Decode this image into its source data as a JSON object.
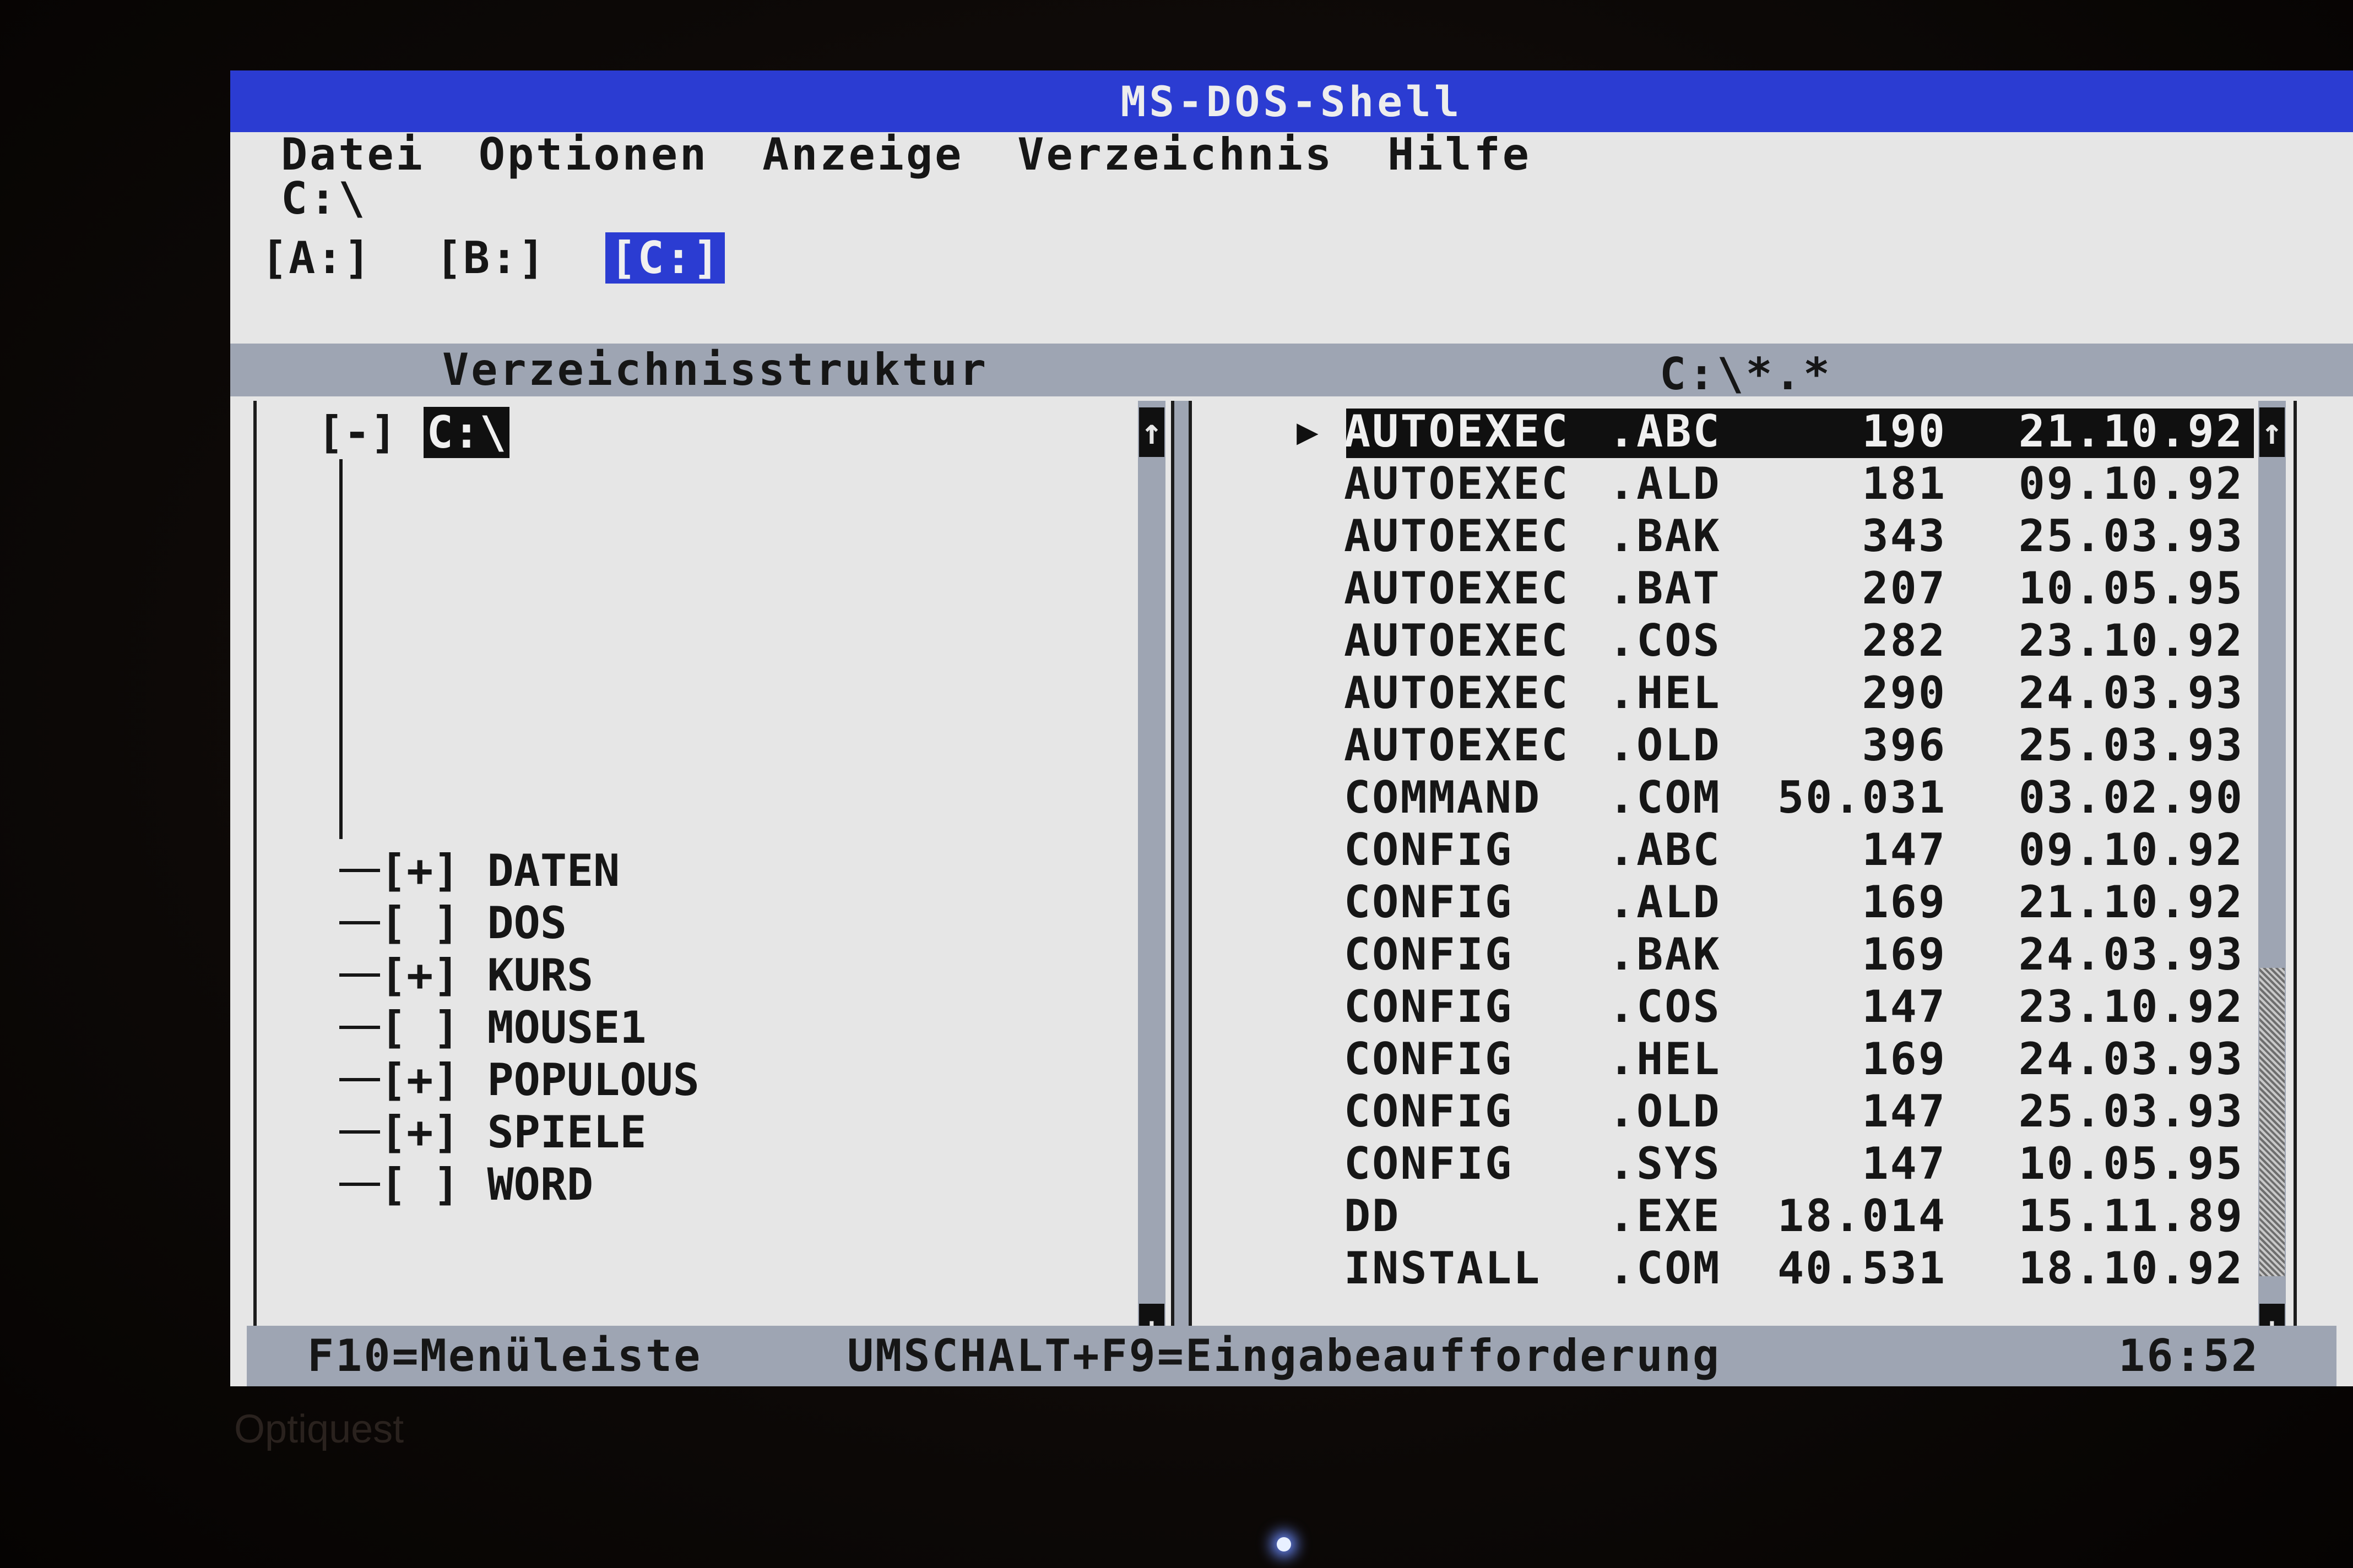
{
  "window": {
    "title": "MS-DOS-Shell"
  },
  "menu": [
    "Datei",
    "Optionen",
    "Anzeige",
    "Verzeichnis",
    "Hilfe"
  ],
  "current_path": "C:\\",
  "drives": [
    {
      "label": "[A:]",
      "active": false
    },
    {
      "label": "[B:]",
      "active": false
    },
    {
      "label": "[C:]",
      "active": true
    }
  ],
  "tree_panel": {
    "title": "Verzeichnisstruktur",
    "root": {
      "marker": "[-]",
      "name": "C:\\"
    },
    "nodes": [
      {
        "marker": "[+]",
        "name": "DATEN"
      },
      {
        "marker": "[ ]",
        "name": "DOS"
      },
      {
        "marker": "[+]",
        "name": "KURS"
      },
      {
        "marker": "[ ]",
        "name": "MOUSE1"
      },
      {
        "marker": "[+]",
        "name": "POPULOUS"
      },
      {
        "marker": "[+]",
        "name": "SPIELE"
      },
      {
        "marker": "[ ]",
        "name": "WORD"
      }
    ]
  },
  "file_panel": {
    "title": "C:\\*.*",
    "files": [
      {
        "name": "AUTOEXEC",
        "ext": ".ABC",
        "size": "190",
        "date": "21.10.92",
        "selected": true
      },
      {
        "name": "AUTOEXEC",
        "ext": ".ALD",
        "size": "181",
        "date": "09.10.92"
      },
      {
        "name": "AUTOEXEC",
        "ext": ".BAK",
        "size": "343",
        "date": "25.03.93"
      },
      {
        "name": "AUTOEXEC",
        "ext": ".BAT",
        "size": "207",
        "date": "10.05.95"
      },
      {
        "name": "AUTOEXEC",
        "ext": ".COS",
        "size": "282",
        "date": "23.10.92"
      },
      {
        "name": "AUTOEXEC",
        "ext": ".HEL",
        "size": "290",
        "date": "24.03.93"
      },
      {
        "name": "AUTOEXEC",
        "ext": ".OLD",
        "size": "396",
        "date": "25.03.93"
      },
      {
        "name": "COMMAND",
        "ext": ".COM",
        "size": "50.031",
        "date": "03.02.90"
      },
      {
        "name": "CONFIG",
        "ext": ".ABC",
        "size": "147",
        "date": "09.10.92"
      },
      {
        "name": "CONFIG",
        "ext": ".ALD",
        "size": "169",
        "date": "21.10.92"
      },
      {
        "name": "CONFIG",
        "ext": ".BAK",
        "size": "169",
        "date": "24.03.93"
      },
      {
        "name": "CONFIG",
        "ext": ".COS",
        "size": "147",
        "date": "23.10.92"
      },
      {
        "name": "CONFIG",
        "ext": ".HEL",
        "size": "169",
        "date": "24.03.93"
      },
      {
        "name": "CONFIG",
        "ext": ".OLD",
        "size": "147",
        "date": "25.03.93"
      },
      {
        "name": "CONFIG",
        "ext": ".SYS",
        "size": "147",
        "date": "10.05.95"
      },
      {
        "name": "DD",
        "ext": ".EXE",
        "size": "18.014",
        "date": "15.11.89"
      },
      {
        "name": "INSTALL",
        "ext": ".COM",
        "size": "40.531",
        "date": "18.10.92"
      }
    ]
  },
  "statusbar": {
    "menu_hint": "F10=Menüleiste",
    "prompt_hint": "UMSCHALT+F9=Eingabeaufforderung",
    "clock": "16:52"
  },
  "icons": {
    "scroll_up": "↑",
    "scroll_down": "↓",
    "selection_pointer": "▶"
  },
  "monitor": {
    "brand": "Optiquest"
  },
  "colors": {
    "titlebar": "#2b3cd2",
    "background": "#e6e6e6",
    "bars": "#9ea5b3",
    "selection": "#101010"
  }
}
